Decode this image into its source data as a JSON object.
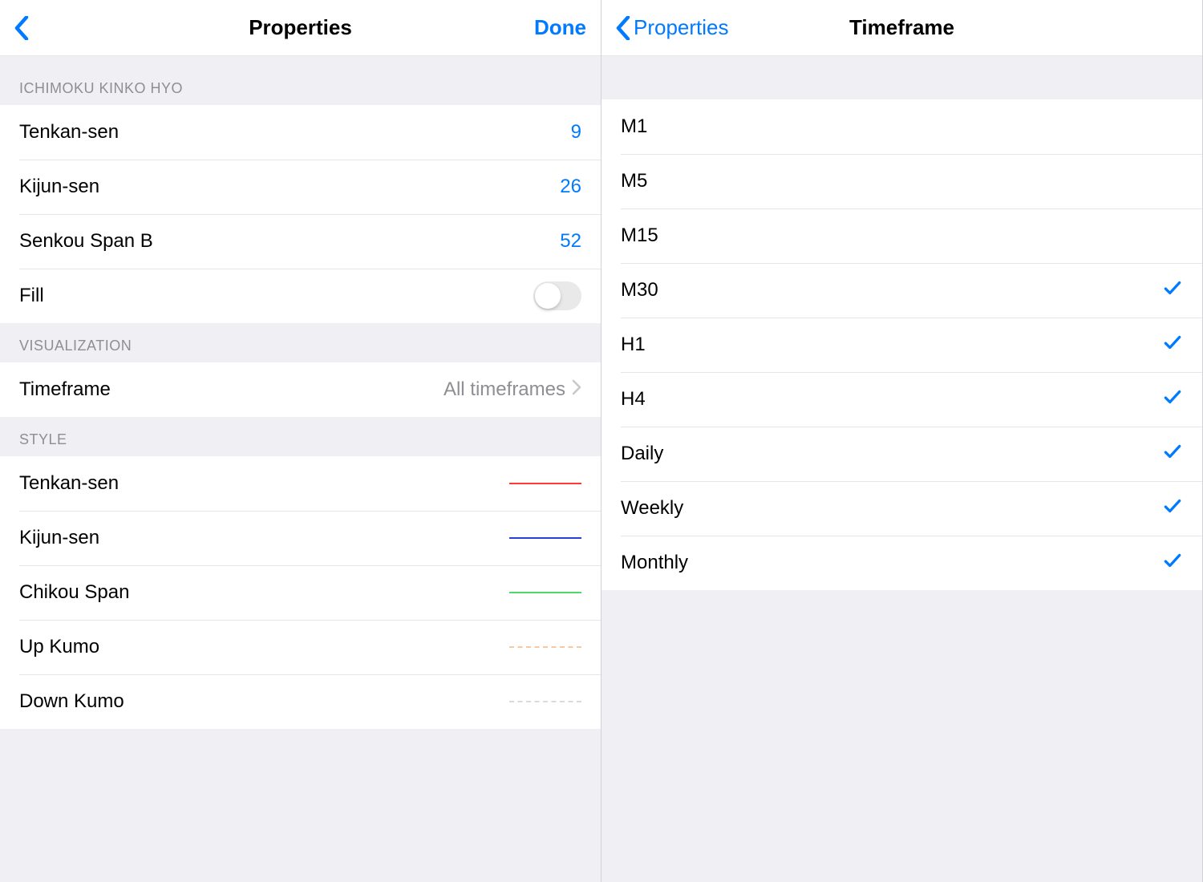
{
  "leftPane": {
    "navTitle": "Properties",
    "doneLabel": "Done",
    "sections": {
      "ichimoku": {
        "header": "ICHIMOKU KINKO HYO",
        "rows": {
          "tenkan": {
            "label": "Tenkan-sen",
            "value": "9"
          },
          "kijun": {
            "label": "Kijun-sen",
            "value": "26"
          },
          "senkouB": {
            "label": "Senkou Span B",
            "value": "52"
          },
          "fill": {
            "label": "Fill"
          }
        }
      },
      "visualization": {
        "header": "VISUALIZATION",
        "timeframe": {
          "label": "Timeframe",
          "value": "All timeframes"
        }
      },
      "style": {
        "header": "STYLE",
        "rows": {
          "tenkan": {
            "label": "Tenkan-sen",
            "color": "#ff3b30",
            "dashed": false
          },
          "kijun": {
            "label": "Kijun-sen",
            "color": "#2b3fd6",
            "dashed": false
          },
          "chikou": {
            "label": "Chikou Span",
            "color": "#4cd964",
            "dashed": false
          },
          "upkumo": {
            "label": "Up Kumo",
            "color": "#f6c9a0",
            "dashed": true
          },
          "downkumo": {
            "label": "Down Kumo",
            "color": "#d9d9de",
            "dashed": true
          }
        }
      }
    }
  },
  "rightPane": {
    "backLabel": "Properties",
    "navTitle": "Timeframe",
    "rows": {
      "m1": {
        "label": "M1",
        "checked": false
      },
      "m5": {
        "label": "M5",
        "checked": false
      },
      "m15": {
        "label": "M15",
        "checked": false
      },
      "m30": {
        "label": "M30",
        "checked": true
      },
      "h1": {
        "label": "H1",
        "checked": true
      },
      "h4": {
        "label": "H4",
        "checked": true
      },
      "daily": {
        "label": "Daily",
        "checked": true
      },
      "weekly": {
        "label": "Weekly",
        "checked": true
      },
      "monthly": {
        "label": "Monthly",
        "checked": true
      }
    }
  }
}
